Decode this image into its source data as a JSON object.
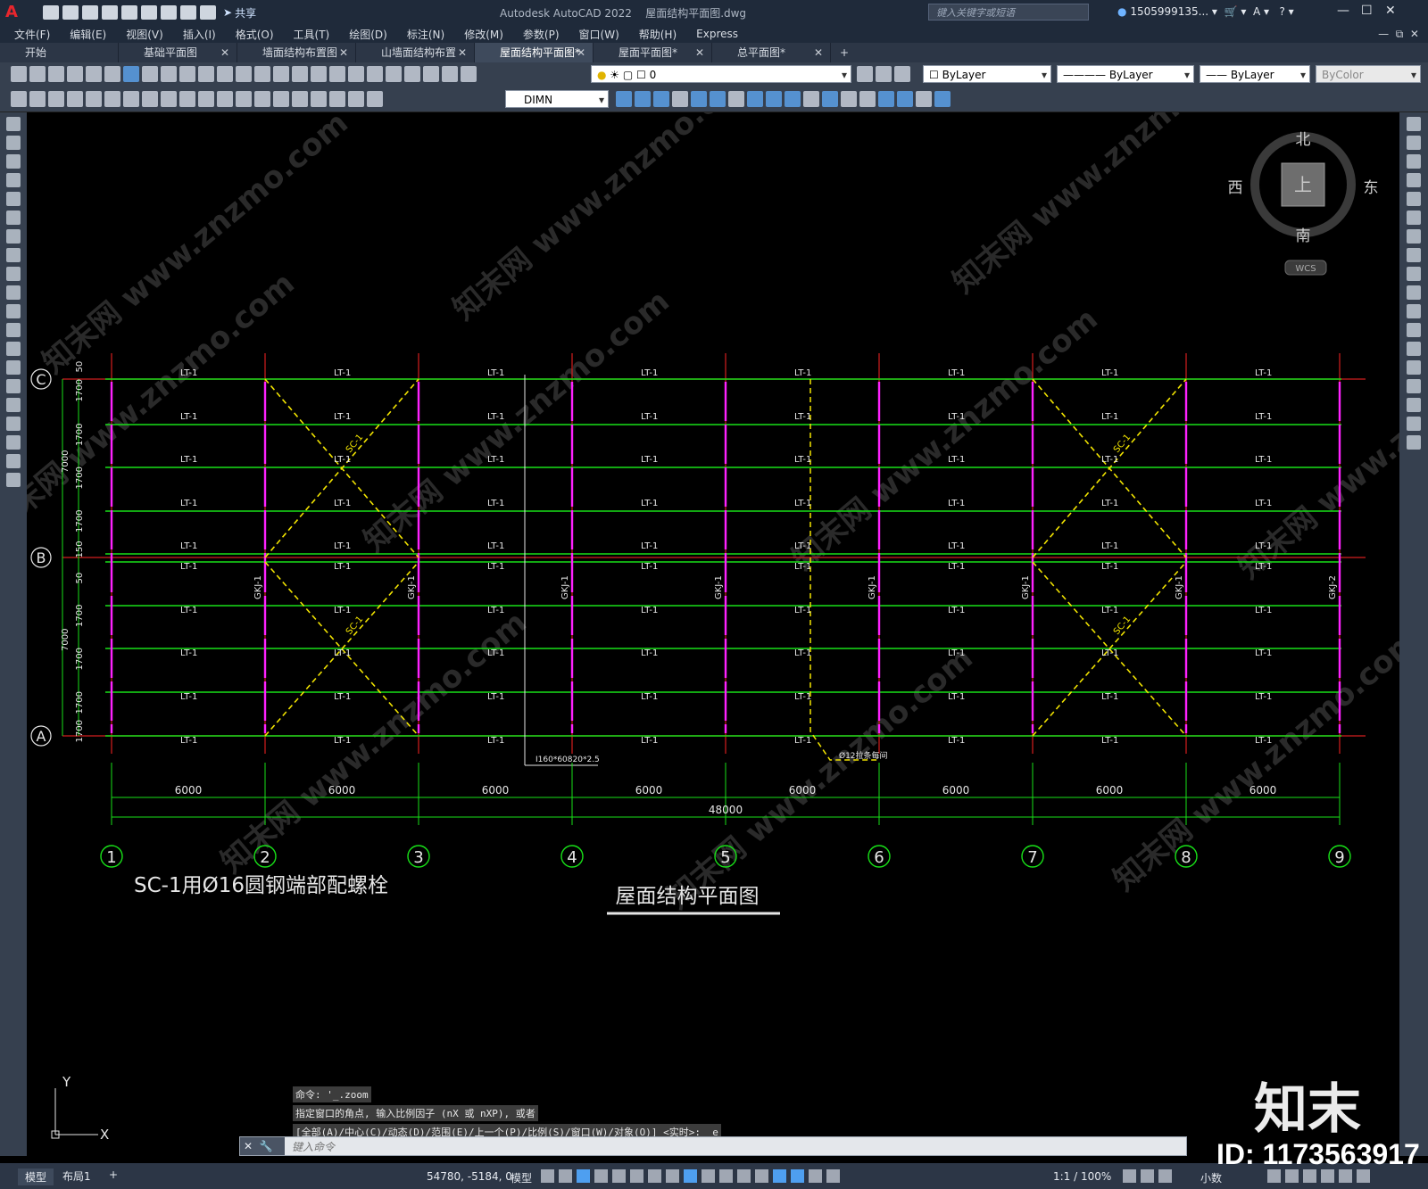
{
  "app": {
    "title": "Autodesk AutoCAD 2022",
    "filename": "屋面结构平面图.dwg",
    "search_placeholder": "键入关键字或短语",
    "user": "1505999135...",
    "share_label": "共享",
    "logo": "A"
  },
  "menu": [
    "文件(F)",
    "编辑(E)",
    "视图(V)",
    "插入(I)",
    "格式(O)",
    "工具(T)",
    "绘图(D)",
    "标注(N)",
    "修改(M)",
    "参数(P)",
    "窗口(W)",
    "帮助(H)",
    "Express"
  ],
  "tabs": [
    {
      "label": "开始",
      "closable": false
    },
    {
      "label": "基础平面图",
      "closable": true
    },
    {
      "label": "墙面结构布置图",
      "closable": true
    },
    {
      "label": "山墙面结构布置图",
      "closable": true
    },
    {
      "label": "屋面结构平面图*",
      "closable": true,
      "active": true
    },
    {
      "label": "屋面平面图*",
      "closable": true
    },
    {
      "label": "总平面图*",
      "closable": true
    }
  ],
  "toolbar": {
    "layer_value": "0",
    "color": "ByLayer",
    "linetype": "ByLayer",
    "lineweight": "ByLayer",
    "plotstyle": "ByColor",
    "dimstyle": "DIMN"
  },
  "viewcube": {
    "north": "北",
    "south": "南",
    "east": "东",
    "west": "西",
    "top": "上",
    "wcs": "WCS"
  },
  "drawing": {
    "title": "屋面结构平面图",
    "note": "SC-1用Ø16圆钢端部配螺栓",
    "grid_columns": [
      "1",
      "2",
      "3",
      "4",
      "5",
      "6",
      "7",
      "8",
      "9"
    ],
    "grid_rows": [
      "C",
      "B",
      "A"
    ],
    "bay_dimension": "6000",
    "total_dimension": "48000",
    "purlin_label": "LT-1",
    "brace_label": "SC-1",
    "frame_labels": [
      "GKJ-1",
      "GKJ-1",
      "GKJ-1",
      "GKJ-1",
      "GKJ-1",
      "GKJ-1",
      "GKJ-1",
      "GKJ-1",
      "GKJ-2"
    ],
    "left_dims": {
      "segments": [
        "50",
        "1700",
        "1700",
        "1700",
        "1700",
        "150",
        "50",
        "1700",
        "1700",
        "1700",
        "1700",
        "50"
      ],
      "totals": [
        "7000",
        "7000"
      ]
    },
    "leader_1": "I160*60820*2.5",
    "leader_2": "Ø12拉条每间",
    "ucs_x": "X",
    "ucs_y": "Y"
  },
  "command": {
    "history": [
      "命令: '_.zoom",
      "指定窗口的角点, 输入比例因子 (nX 或 nXP), 或者",
      "[全部(A)/中心(C)/动态(D)/范围(E)/上一个(P)/比例(S)/窗口(W)/对象(O)] <实时>: _e"
    ],
    "placeholder": "键入命令"
  },
  "status": {
    "model_tab": "模型",
    "layout_tab": "布局1",
    "coords": "54780, -5184, 0",
    "mode": "模型",
    "scale": "1:1 / 100%",
    "units": "小数"
  },
  "watermark": {
    "brand": "知末",
    "id": "ID: 1173563917",
    "diag": "知末网 www.znzmo.com"
  }
}
